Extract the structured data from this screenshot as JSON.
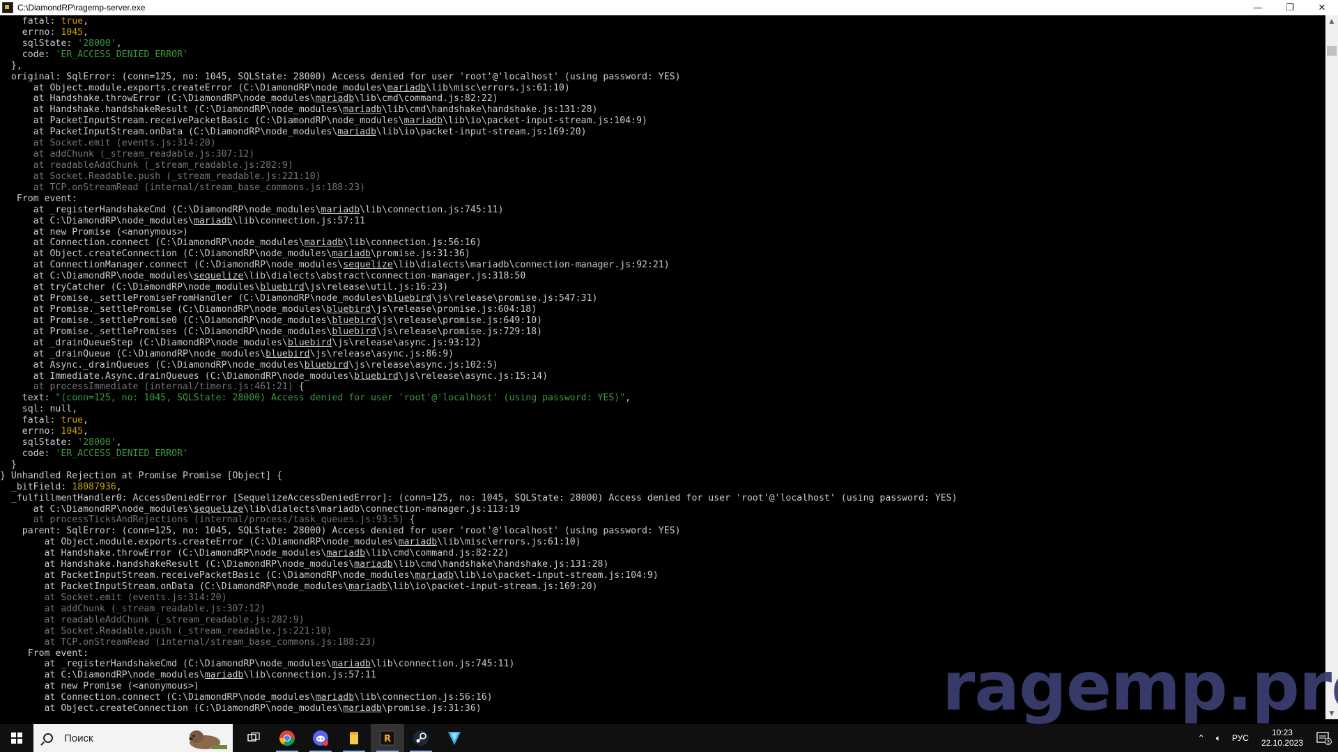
{
  "window": {
    "title": "C:\\DiamondRP\\ragemp-server.exe",
    "minimize_glyph": "—",
    "maximize_glyph": "❐",
    "close_glyph": "✕"
  },
  "console": {
    "lines": [
      [
        [
          "    fatal: ",
          ""
        ],
        [
          "true",
          "y"
        ],
        [
          ",",
          ""
        ]
      ],
      [
        [
          "    errno: ",
          ""
        ],
        [
          "1045",
          "y"
        ],
        [
          ",",
          ""
        ]
      ],
      [
        [
          "    sqlState: ",
          ""
        ],
        [
          "'28000'",
          "g"
        ],
        [
          ",",
          ""
        ]
      ],
      [
        [
          "    code: ",
          ""
        ],
        [
          "'ER_ACCESS_DENIED_ERROR'",
          "g"
        ]
      ],
      [
        [
          "  },",
          ""
        ]
      ],
      [
        [
          "  original: SqlError: (conn=125, no: 1045, SQLState: 28000) Access denied for user 'root'@'localhost' (using password: YES)",
          ""
        ]
      ],
      [
        [
          "      at Object.module.exports.createError (C:\\DiamondRP\\node_modules\\",
          ""
        ],
        [
          "mariadb",
          "u"
        ],
        [
          "\\lib\\misc\\errors.js:61:10)",
          ""
        ]
      ],
      [
        [
          "      at Handshake.throwError (C:\\DiamondRP\\node_modules\\",
          ""
        ],
        [
          "mariadb",
          "u"
        ],
        [
          "\\lib\\cmd\\command.js:82:22)",
          ""
        ]
      ],
      [
        [
          "      at Handshake.handshakeResult (C:\\DiamondRP\\node_modules\\",
          ""
        ],
        [
          "mariadb",
          "u"
        ],
        [
          "\\lib\\cmd\\handshake\\handshake.js:131:28)",
          ""
        ]
      ],
      [
        [
          "      at PacketInputStream.receivePacketBasic (C:\\DiamondRP\\node_modules\\",
          ""
        ],
        [
          "mariadb",
          "u"
        ],
        [
          "\\lib\\io\\packet-input-stream.js:104:9)",
          ""
        ]
      ],
      [
        [
          "      at PacketInputStream.onData (C:\\DiamondRP\\node_modules\\",
          ""
        ],
        [
          "mariadb",
          "u"
        ],
        [
          "\\lib\\io\\packet-input-stream.js:169:20)",
          ""
        ]
      ],
      [
        [
          "      at Socket.emit (events.js:314:20)",
          "dim"
        ]
      ],
      [
        [
          "      at addChunk (_stream_readable.js:307:12)",
          "dim"
        ]
      ],
      [
        [
          "      at readableAddChunk (_stream_readable.js:282:9)",
          "dim"
        ]
      ],
      [
        [
          "      at Socket.Readable.push (_stream_readable.js:221:10)",
          "dim"
        ]
      ],
      [
        [
          "      at TCP.onStreamRead (internal/stream_base_commons.js:188:23)",
          "dim"
        ]
      ],
      [
        [
          "   From event:",
          ""
        ]
      ],
      [
        [
          "      at _registerHandshakeCmd (C:\\DiamondRP\\node_modules\\",
          ""
        ],
        [
          "mariadb",
          "u"
        ],
        [
          "\\lib\\connection.js:745:11)",
          ""
        ]
      ],
      [
        [
          "      at C:\\DiamondRP\\node_modules\\",
          ""
        ],
        [
          "mariadb",
          "u"
        ],
        [
          "\\lib\\connection.js:57:11",
          ""
        ]
      ],
      [
        [
          "      at new Promise (<anonymous>)",
          ""
        ]
      ],
      [
        [
          "      at Connection.connect (C:\\DiamondRP\\node_modules\\",
          ""
        ],
        [
          "mariadb",
          "u"
        ],
        [
          "\\lib\\connection.js:56:16)",
          ""
        ]
      ],
      [
        [
          "      at Object.createConnection (C:\\DiamondRP\\node_modules\\",
          ""
        ],
        [
          "mariadb",
          "u"
        ],
        [
          "\\promise.js:31:36)",
          ""
        ]
      ],
      [
        [
          "      at ConnectionManager.connect (C:\\DiamondRP\\node_modules\\",
          ""
        ],
        [
          "sequelize",
          "u"
        ],
        [
          "\\lib\\dialects\\mariadb\\connection-manager.js:92:21)",
          ""
        ]
      ],
      [
        [
          "      at C:\\DiamondRP\\node_modules\\",
          ""
        ],
        [
          "sequelize",
          "u"
        ],
        [
          "\\lib\\dialects\\abstract\\connection-manager.js:318:50",
          ""
        ]
      ],
      [
        [
          "      at tryCatcher (C:\\DiamondRP\\node_modules\\",
          ""
        ],
        [
          "bluebird",
          "u"
        ],
        [
          "\\js\\release\\util.js:16:23)",
          ""
        ]
      ],
      [
        [
          "      at Promise._settlePromiseFromHandler (C:\\DiamondRP\\node_modules\\",
          ""
        ],
        [
          "bluebird",
          "u"
        ],
        [
          "\\js\\release\\promise.js:547:31)",
          ""
        ]
      ],
      [
        [
          "      at Promise._settlePromise (C:\\DiamondRP\\node_modules\\",
          ""
        ],
        [
          "bluebird",
          "u"
        ],
        [
          "\\js\\release\\promise.js:604:18)",
          ""
        ]
      ],
      [
        [
          "      at Promise._settlePromise0 (C:\\DiamondRP\\node_modules\\",
          ""
        ],
        [
          "bluebird",
          "u"
        ],
        [
          "\\js\\release\\promise.js:649:10)",
          ""
        ]
      ],
      [
        [
          "      at Promise._settlePromises (C:\\DiamondRP\\node_modules\\",
          ""
        ],
        [
          "bluebird",
          "u"
        ],
        [
          "\\js\\release\\promise.js:729:18)",
          ""
        ]
      ],
      [
        [
          "      at _drainQueueStep (C:\\DiamondRP\\node_modules\\",
          ""
        ],
        [
          "bluebird",
          "u"
        ],
        [
          "\\js\\release\\async.js:93:12)",
          ""
        ]
      ],
      [
        [
          "      at _drainQueue (C:\\DiamondRP\\node_modules\\",
          ""
        ],
        [
          "bluebird",
          "u"
        ],
        [
          "\\js\\release\\async.js:86:9)",
          ""
        ]
      ],
      [
        [
          "      at Async._drainQueues (C:\\DiamondRP\\node_modules\\",
          ""
        ],
        [
          "bluebird",
          "u"
        ],
        [
          "\\js\\release\\async.js:102:5)",
          ""
        ]
      ],
      [
        [
          "      at Immediate.Async.drainQueues (C:\\DiamondRP\\node_modules\\",
          ""
        ],
        [
          "bluebird",
          "u"
        ],
        [
          "\\js\\release\\async.js:15:14)",
          ""
        ]
      ],
      [
        [
          "      at processImmediate (internal/timers.js:461:21)",
          "dim"
        ],
        [
          " {",
          ""
        ]
      ],
      [
        [
          "    text: ",
          ""
        ],
        [
          "\"(conn=125, no: 1045, SQLState: 28000) Access denied for user 'root'@'localhost' (using password: YES)\"",
          "g"
        ],
        [
          ",",
          ""
        ]
      ],
      [
        [
          "    sql: null,",
          ""
        ]
      ],
      [
        [
          "    fatal: ",
          ""
        ],
        [
          "true",
          "y"
        ],
        [
          ",",
          ""
        ]
      ],
      [
        [
          "    errno: ",
          ""
        ],
        [
          "1045",
          "y"
        ],
        [
          ",",
          ""
        ]
      ],
      [
        [
          "    sqlState: ",
          ""
        ],
        [
          "'28000'",
          "g"
        ],
        [
          ",",
          ""
        ]
      ],
      [
        [
          "    code: ",
          ""
        ],
        [
          "'ER_ACCESS_DENIED_ERROR'",
          "g"
        ]
      ],
      [
        [
          "  }",
          ""
        ]
      ],
      [
        [
          "} Unhandled Rejection at Promise Promise [Object] {",
          ""
        ]
      ],
      [
        [
          "  _bitField: ",
          ""
        ],
        [
          "18087936",
          "y"
        ],
        [
          ",",
          ""
        ]
      ],
      [
        [
          "  _fulfillmentHandler0: AccessDeniedError [SequelizeAccessDeniedError]: (conn=125, no: 1045, SQLState: 28000) Access denied for user 'root'@'localhost' (using password: YES)",
          ""
        ]
      ],
      [
        [
          "      at C:\\DiamondRP\\node_modules\\",
          ""
        ],
        [
          "sequelize",
          "u"
        ],
        [
          "\\lib\\dialects\\mariadb\\connection-manager.js:113:19",
          ""
        ]
      ],
      [
        [
          "      at processTicksAndRejections (internal/process/task_queues.js:93:5)",
          "dim"
        ],
        [
          " {",
          ""
        ]
      ],
      [
        [
          "    parent: SqlError: (conn=125, no: 1045, SQLState: 28000) Access denied for user 'root'@'localhost' (using password: YES)",
          ""
        ]
      ],
      [
        [
          "        at Object.module.exports.createError (C:\\DiamondRP\\node_modules\\",
          ""
        ],
        [
          "mariadb",
          "u"
        ],
        [
          "\\lib\\misc\\errors.js:61:10)",
          ""
        ]
      ],
      [
        [
          "        at Handshake.throwError (C:\\DiamondRP\\node_modules\\",
          ""
        ],
        [
          "mariadb",
          "u"
        ],
        [
          "\\lib\\cmd\\command.js:82:22)",
          ""
        ]
      ],
      [
        [
          "        at Handshake.handshakeResult (C:\\DiamondRP\\node_modules\\",
          ""
        ],
        [
          "mariadb",
          "u"
        ],
        [
          "\\lib\\cmd\\handshake\\handshake.js:131:28)",
          ""
        ]
      ],
      [
        [
          "        at PacketInputStream.receivePacketBasic (C:\\DiamondRP\\node_modules\\",
          ""
        ],
        [
          "mariadb",
          "u"
        ],
        [
          "\\lib\\io\\packet-input-stream.js:104:9)",
          ""
        ]
      ],
      [
        [
          "        at PacketInputStream.onData (C:\\DiamondRP\\node_modules\\",
          ""
        ],
        [
          "mariadb",
          "u"
        ],
        [
          "\\lib\\io\\packet-input-stream.js:169:20)",
          ""
        ]
      ],
      [
        [
          "        at Socket.emit (events.js:314:20)",
          "dim"
        ]
      ],
      [
        [
          "        at addChunk (_stream_readable.js:307:12)",
          "dim"
        ]
      ],
      [
        [
          "        at readableAddChunk (_stream_readable.js:282:9)",
          "dim"
        ]
      ],
      [
        [
          "        at Socket.Readable.push (_stream_readable.js:221:10)",
          "dim"
        ]
      ],
      [
        [
          "        at TCP.onStreamRead (internal/stream_base_commons.js:188:23)",
          "dim"
        ]
      ],
      [
        [
          "     From event:",
          ""
        ]
      ],
      [
        [
          "        at _registerHandshakeCmd (C:\\DiamondRP\\node_modules\\",
          ""
        ],
        [
          "mariadb",
          "u"
        ],
        [
          "\\lib\\connection.js:745:11)",
          ""
        ]
      ],
      [
        [
          "        at C:\\DiamondRP\\node_modules\\",
          ""
        ],
        [
          "mariadb",
          "u"
        ],
        [
          "\\lib\\connection.js:57:11",
          ""
        ]
      ],
      [
        [
          "        at new Promise (<anonymous>)",
          ""
        ]
      ],
      [
        [
          "        at Connection.connect (C:\\DiamondRP\\node_modules\\",
          ""
        ],
        [
          "mariadb",
          "u"
        ],
        [
          "\\lib\\connection.js:56:16)",
          ""
        ]
      ],
      [
        [
          "        at Object.createConnection (C:\\DiamondRP\\node_modules\\",
          ""
        ],
        [
          "mariadb",
          "u"
        ],
        [
          "\\promise.js:31:36)",
          ""
        ]
      ]
    ]
  },
  "watermark": "ragemp.pro",
  "taskbar": {
    "search_placeholder": "Поиск",
    "apps": [
      {
        "icon": "task-view-icon"
      },
      {
        "icon": "chrome-icon"
      },
      {
        "icon": "discord-icon"
      },
      {
        "icon": "file-explorer-icon"
      },
      {
        "icon": "ragemp-icon"
      },
      {
        "icon": "steam-icon"
      },
      {
        "icon": "vpn-shield-icon"
      }
    ],
    "tray": {
      "language": "РУС",
      "time": "10:23",
      "date": "22.10.2023",
      "notification_count": "3"
    }
  },
  "colors": {
    "console_bg": "#000000",
    "text": "#cccccc",
    "string": "#3a9a3a",
    "number": "#c8a000",
    "dim": "#767676",
    "watermark": "#3a3d6e"
  }
}
